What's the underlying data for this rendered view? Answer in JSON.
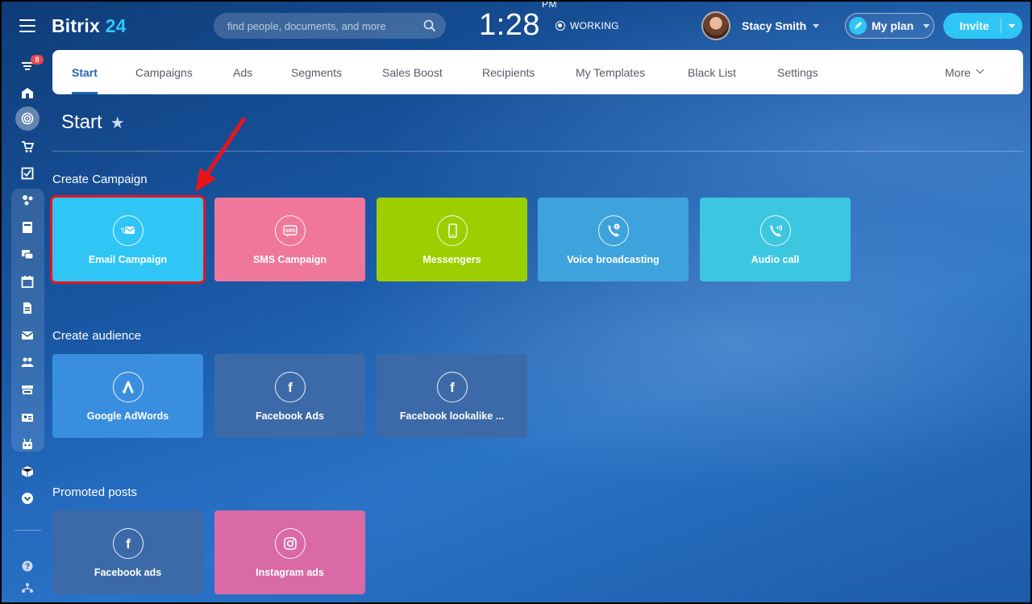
{
  "header": {
    "logo_text": "Bitrix",
    "logo_num": "24",
    "search_placeholder": "find people, documents, and more",
    "time": "1:28",
    "ampm": "PM",
    "status": "WORKING",
    "username": "Stacy Smith",
    "plan_label": "My plan",
    "invite_label": "Invite"
  },
  "sidebar": {
    "notification_count": "8",
    "icons": [
      "filter-icon",
      "home-icon",
      "target-icon",
      "cart-icon",
      "checkbox-icon",
      "crm-icon",
      "document-icon",
      "chat-icon",
      "calendar-icon",
      "file-icon",
      "mail-icon",
      "users-icon",
      "store-icon",
      "contact-card-icon",
      "robot-icon",
      "box-icon",
      "chevron-down-circle-icon",
      "help-icon",
      "sitemap-icon"
    ]
  },
  "nav": {
    "tabs": [
      "Start",
      "Campaigns",
      "Ads",
      "Segments",
      "Sales Boost",
      "Recipients",
      "My Templates",
      "Black List",
      "Settings"
    ],
    "more": "More",
    "active": "Start"
  },
  "page": {
    "title": "Start"
  },
  "sections": {
    "campaign": {
      "title": "Create Campaign",
      "tiles": [
        {
          "label": "Email Campaign",
          "color": "#2fc6f6",
          "icon": "email-icon"
        },
        {
          "label": "SMS Campaign",
          "color": "#f0779c",
          "icon": "sms-icon"
        },
        {
          "label": "Messengers",
          "color": "#9dcf00",
          "icon": "smartphone-icon"
        },
        {
          "label": "Voice broadcasting",
          "color": "#3ea3dc",
          "icon": "phone-alert-icon"
        },
        {
          "label": "Audio call",
          "color": "#3cc6e0",
          "icon": "phone-volume-icon"
        }
      ]
    },
    "audience": {
      "title": "Create audience",
      "tiles": [
        {
          "label": "Google AdWords",
          "color": "#3a8ee0",
          "icon": "adwords-icon"
        },
        {
          "label": "Facebook Ads",
          "color": "#3c6aa8",
          "icon": "facebook-icon"
        },
        {
          "label": "Facebook lookalike ...",
          "color": "#3c6aa8",
          "icon": "facebook-icon"
        }
      ]
    },
    "promoted": {
      "title": "Promoted posts",
      "tiles": [
        {
          "label": "Facebook ads",
          "color": "#3c6aa8",
          "icon": "facebook-icon"
        },
        {
          "label": "Instagram ads",
          "color": "#d96aa6",
          "icon": "instagram-icon"
        }
      ]
    }
  }
}
